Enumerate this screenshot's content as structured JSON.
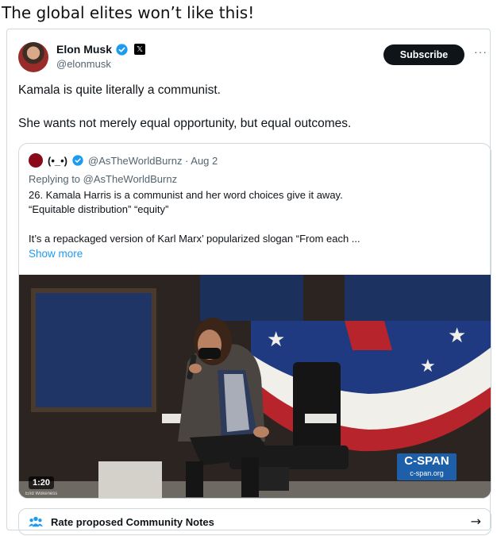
{
  "caption": "The global elites won’t like this!",
  "tweet": {
    "author_name": "Elon Musk",
    "author_handle": "@elonmusk",
    "subscribe_label": "Subscribe",
    "more_label": "···",
    "text_line1": "Kamala is quite literally a communist.",
    "text_line2": "She wants not merely equal opportunity, but equal outcomes."
  },
  "quote": {
    "name": "(•_•)",
    "handle_date": "@AsTheWorldBurnz · Aug 2",
    "replying_to": "Replying to @AsTheWorldBurnz",
    "line1": "26. Kamala Harris is a communist and her word choices give it away.",
    "line2": "“Equitable distribution” “equity”",
    "line3": "It’s a repackaged version of Karl Marx’ popularized slogan “From each ...",
    "show_more": "Show more"
  },
  "video": {
    "timecode": "1:20",
    "watermark": "End Wokeness",
    "network": "C-SPAN",
    "network_url": "c-span.org"
  },
  "community_notes": {
    "label": "Rate proposed Community Notes",
    "arrow": "→"
  },
  "colors": {
    "link": "#1d9bf0",
    "verified": "#1d9bf0",
    "cspan": "#1d5fa8"
  }
}
